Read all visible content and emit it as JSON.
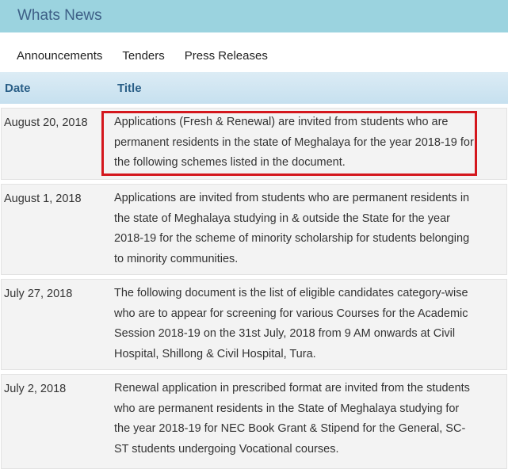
{
  "header": {
    "title": "Whats News"
  },
  "tabs": [
    {
      "label": "Announcements"
    },
    {
      "label": "Tenders"
    },
    {
      "label": "Press Releases"
    }
  ],
  "table": {
    "columns": {
      "date": "Date",
      "title": "Title"
    },
    "rows": [
      {
        "date": "August 20, 2018",
        "title": "Applications (Fresh & Renewal) are invited from students who are permanent residents in the state of Meghalaya for the year 2018-19 for the following schemes listed in the document."
      },
      {
        "date": "August 1, 2018",
        "title": "Applications are invited from students who are permanent residents in the state of Meghalaya studying in & outside the State for the year 2018-19 for the scheme of minority scholarship for students belonging to minority communities."
      },
      {
        "date": "July 27, 2018",
        "title": "The following document is the list of eligible candidates category-wise who are to appear for screening for various Courses for the Academic Session 2018-19 on the 31st July, 2018 from 9 AM onwards at Civil Hospital, Shillong & Civil Hospital, Tura."
      },
      {
        "date": "July 2, 2018",
        "title": "Renewal application in prescribed format are invited from the students who are permanent residents in the State of Meghalaya studying for the year 2018-19 for NEC Book Grant & Stipend for the General, SC-ST students undergoing Vocational courses."
      }
    ]
  },
  "colors": {
    "header_bg": "#9bd3df",
    "header_text": "#3d5f86",
    "table_head_text": "#2a5f87",
    "highlight_border": "#d4171d"
  }
}
